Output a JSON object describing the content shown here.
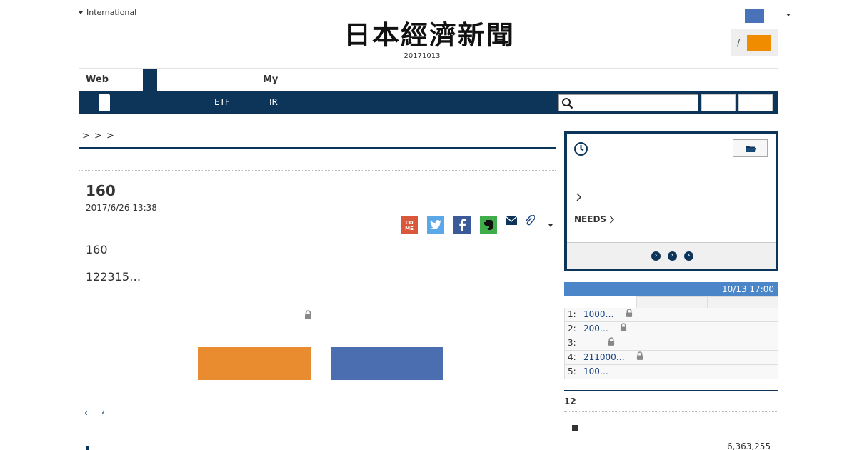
{
  "header": {
    "international_label": "International",
    "logo_text": "日本經濟新聞",
    "date": "20171013",
    "login_sep": "/"
  },
  "tabs": {
    "web": "Web",
    "my": "My"
  },
  "nav": {
    "etf": "ETF",
    "ir": "IR"
  },
  "breadcrumb": "> > >",
  "article": {
    "title": "160",
    "date": "2017/6/26 13:38",
    "body_1": "160",
    "body_2": "122315…",
    "share_come_label": "CO\nME"
  },
  "pager": {
    "prev": "‹",
    "prev2": "‹"
  },
  "panel": {
    "chevron": ">",
    "needs_label": "NEEDS",
    "needs_chevron": ">"
  },
  "ranking": {
    "timestamp": "10/13 17:00",
    "rows": [
      {
        "num": "1:",
        "text": "1000…",
        "lock": true
      },
      {
        "num": "2:",
        "text": "200…",
        "lock": true
      },
      {
        "num": "3:",
        "text": "",
        "lock": true
      },
      {
        "num": "4:",
        "text": "211000…",
        "lock": true
      },
      {
        "num": "5:",
        "text": "100…",
        "lock": false
      }
    ]
  },
  "section": {
    "title": "12",
    "value": "6,363,255"
  },
  "colors": {
    "navy": "#0d3559",
    "orange": "#e98c2f",
    "blue": "#4a6eb0",
    "ranking_header": "#4a86c8"
  }
}
